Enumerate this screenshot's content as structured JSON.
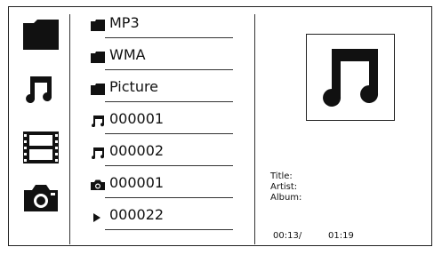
{
  "sidebar": {
    "items": [
      {
        "icon": "folder-icon"
      },
      {
        "icon": "music-note-icon"
      },
      {
        "icon": "film-icon"
      },
      {
        "icon": "camera-icon"
      }
    ]
  },
  "file_list": {
    "items": [
      {
        "icon": "folder-icon",
        "label": "MP3"
      },
      {
        "icon": "folder-icon",
        "label": "WMA"
      },
      {
        "icon": "folder-icon",
        "label": "Picture"
      },
      {
        "icon": "music-note-icon",
        "label": "000001"
      },
      {
        "icon": "music-note-icon",
        "label": "000002"
      },
      {
        "icon": "camera-icon",
        "label": "000001"
      },
      {
        "icon": "play-icon",
        "label": "000022"
      }
    ]
  },
  "info": {
    "cover_icon": "music-note-icon",
    "title_label": "Title:",
    "artist_label": "Artist:",
    "album_label": "Album:",
    "elapsed": "00:13/",
    "total": "01:19"
  }
}
